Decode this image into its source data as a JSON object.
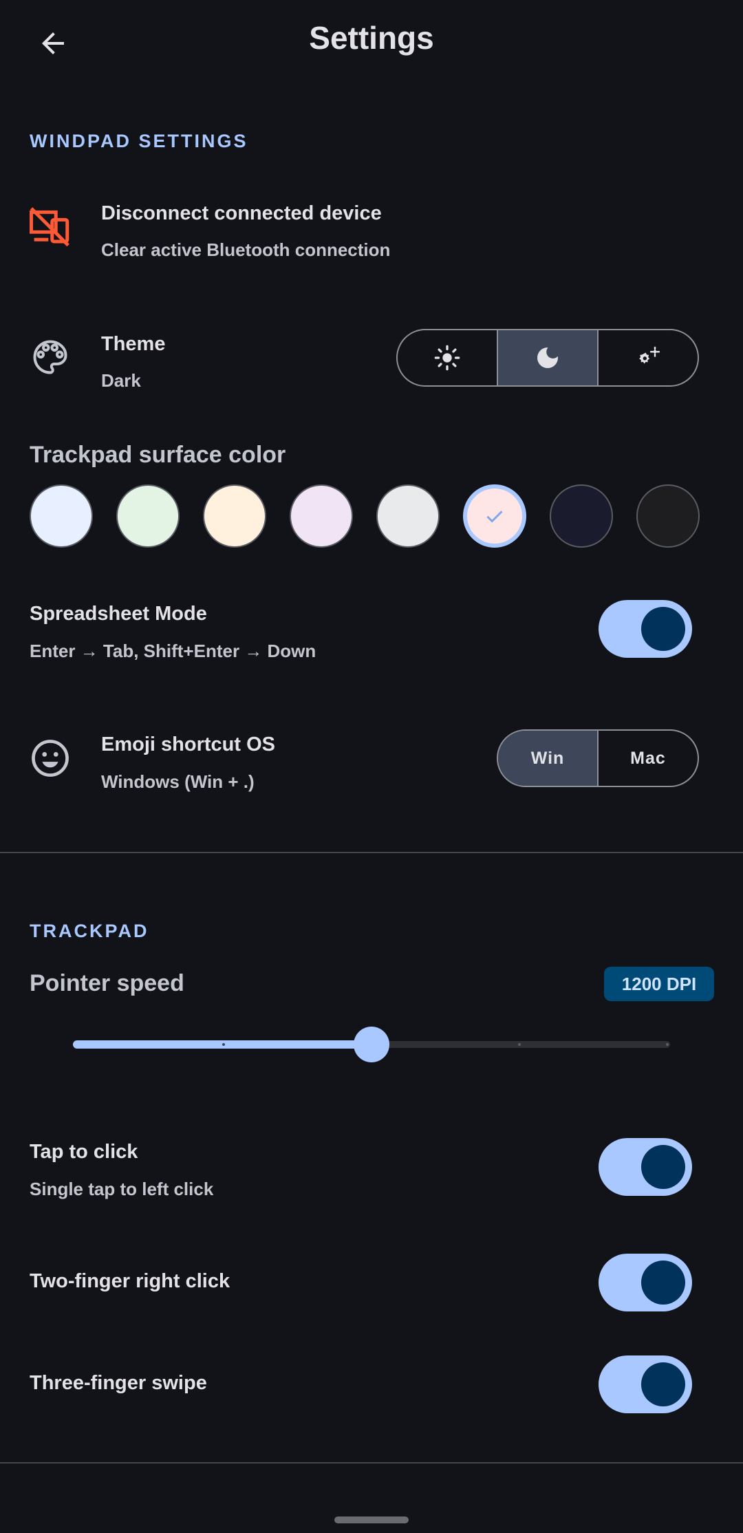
{
  "appbar": {
    "title": "Settings",
    "back_icon": "arrow-back-icon"
  },
  "windpad_section": {
    "header": "WINDPAD SETTINGS",
    "disconnect": {
      "title": "Disconnect connected device",
      "subtitle": "Clear active Bluetooth connection",
      "icon": "device-disconnect-icon",
      "icon_color": "#ff5a36"
    },
    "theme": {
      "title": "Theme",
      "subtitle": "Dark",
      "icon": "palette-icon",
      "options": [
        {
          "icon": "light-mode-icon",
          "selected": false
        },
        {
          "icon": "dark-mode-icon",
          "selected": true
        },
        {
          "icon": "auto-settings-icon",
          "selected": false
        }
      ]
    },
    "surface_color": {
      "label": "Trackpad surface color",
      "swatches": [
        "#e8f0ff",
        "#e4f4e4",
        "#fff1de",
        "#f1e4f4",
        "#e8eaec",
        "#ffe6e6",
        "#1b1b2e",
        "#1e1e20"
      ],
      "selected_index": 5
    },
    "spreadsheet": {
      "title": "Spreadsheet Mode",
      "subtitle": "Enter → Tab, Shift+Enter → Down",
      "enabled": true
    },
    "emoji": {
      "title": "Emoji shortcut OS",
      "subtitle": "Windows (Win + .)",
      "icon": "emoji-face-icon",
      "options": [
        {
          "label": "Win",
          "selected": true
        },
        {
          "label": "Mac",
          "selected": false
        }
      ]
    }
  },
  "trackpad_section": {
    "header": "TRACKPAD",
    "pointer_speed": {
      "label": "Pointer speed",
      "badge": "1200 DPI",
      "value_fraction": 0.5
    },
    "tap_to_click": {
      "title": "Tap to click",
      "subtitle": "Single tap to left click",
      "enabled": true
    },
    "two_finger": {
      "title": "Two-finger right click",
      "enabled": true
    },
    "three_finger": {
      "title": "Three-finger swipe",
      "enabled": true
    }
  },
  "colors": {
    "accent": "#a8c8ff",
    "background": "#121318",
    "switch_thumb": "#00325b"
  }
}
